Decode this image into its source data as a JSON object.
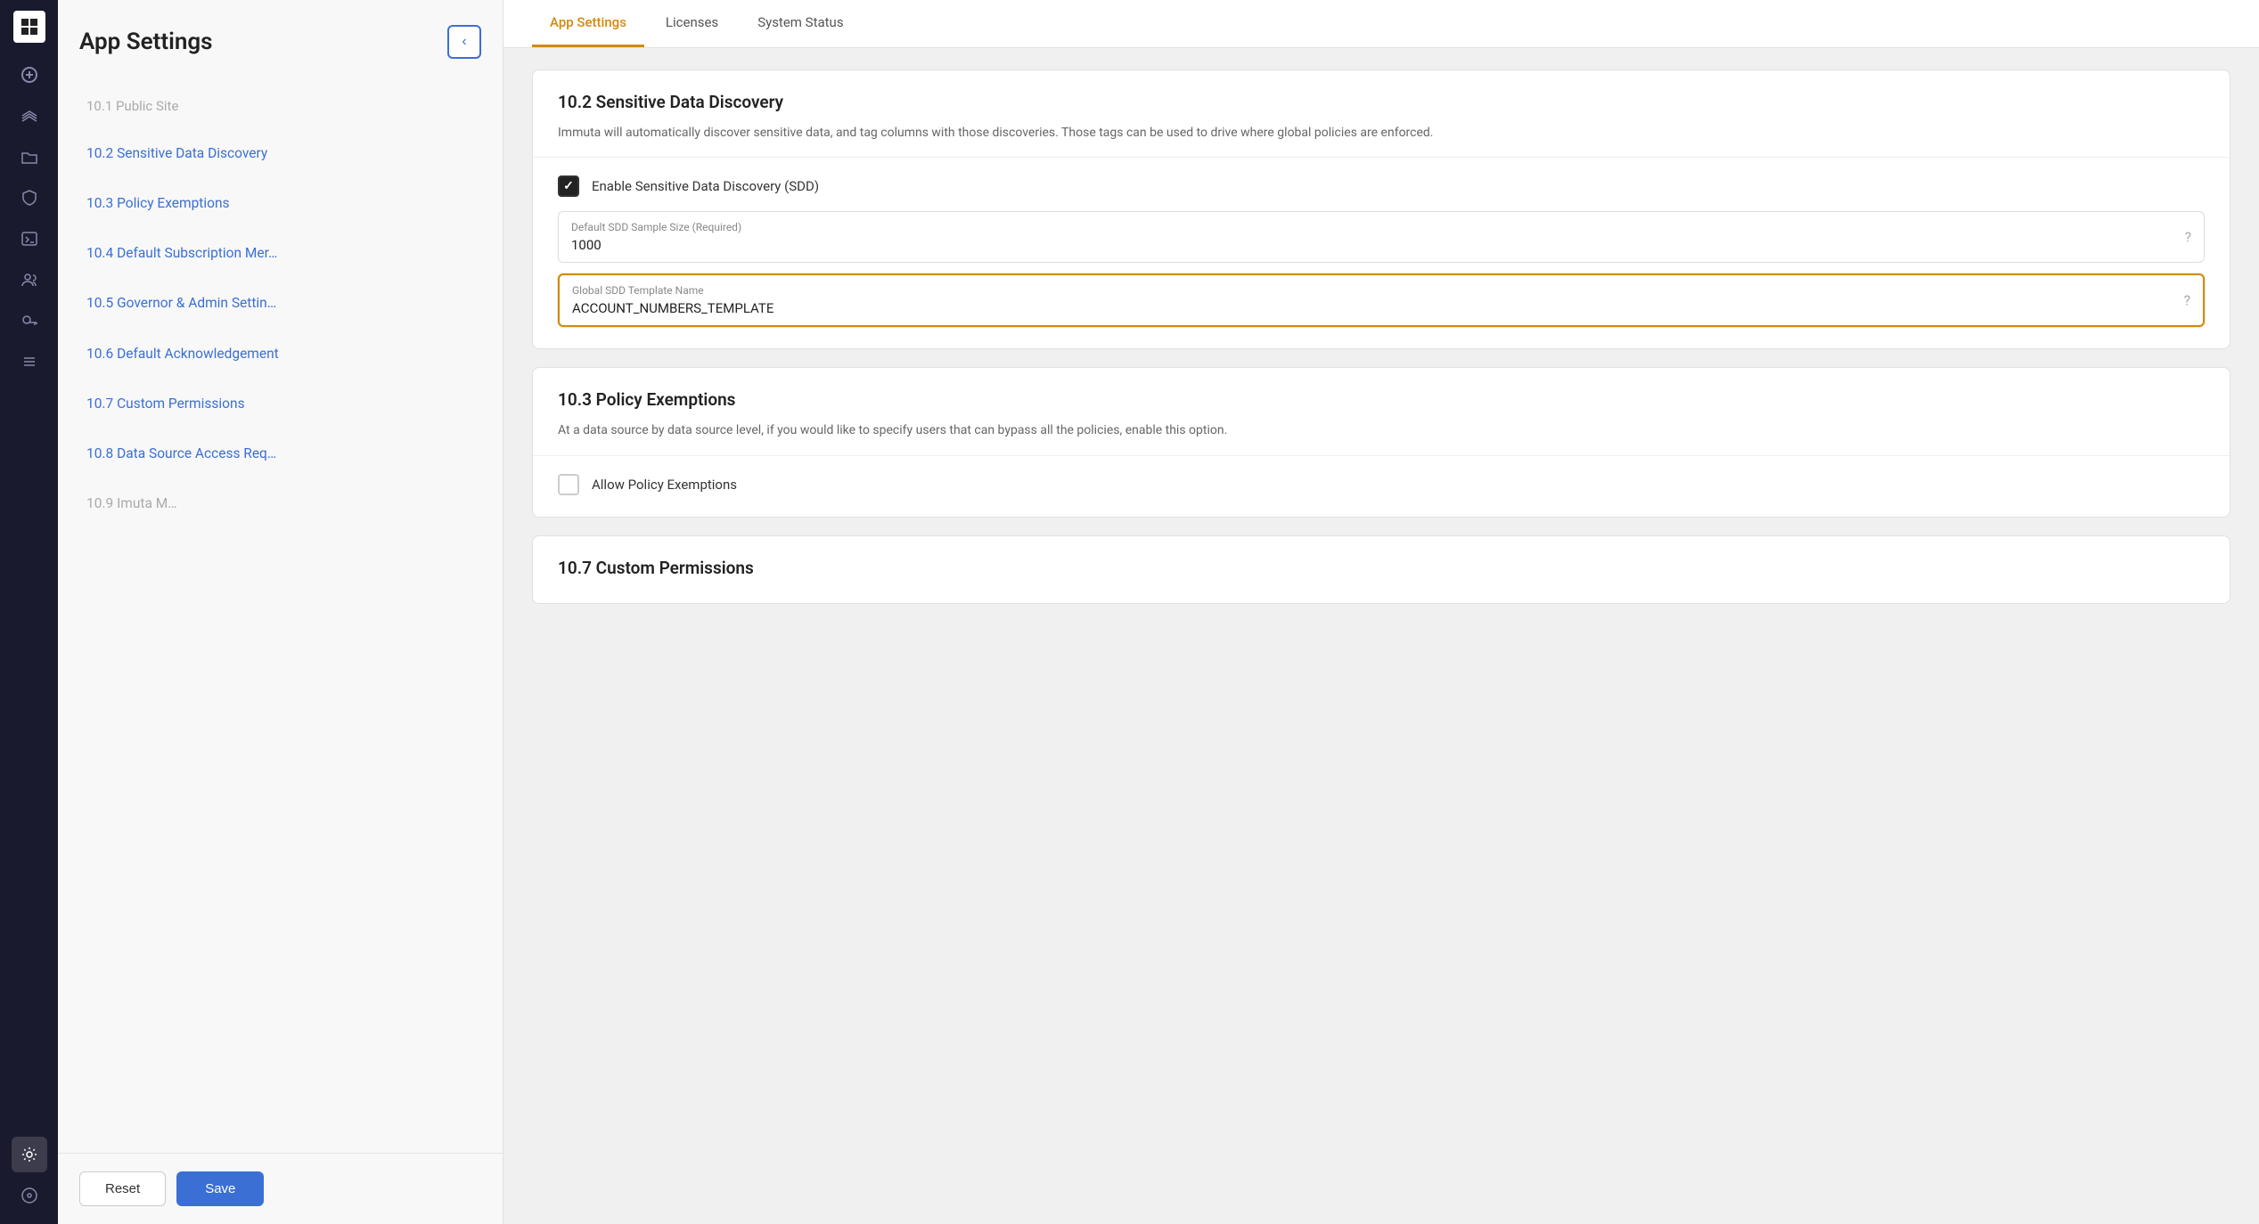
{
  "app": {
    "title": "App Settings"
  },
  "nav": {
    "logo_char": "▐",
    "icons": [
      {
        "name": "add-icon",
        "symbol": "+",
        "active": false
      },
      {
        "name": "layers-icon",
        "symbol": "⊞",
        "active": false
      },
      {
        "name": "folder-icon",
        "symbol": "🗂",
        "active": false
      },
      {
        "name": "shield-icon",
        "symbol": "⛨",
        "active": false
      },
      {
        "name": "terminal-icon",
        "symbol": ">_",
        "active": false
      },
      {
        "name": "users-icon",
        "symbol": "👥",
        "active": false
      },
      {
        "name": "key-icon",
        "symbol": "🔑",
        "active": false
      },
      {
        "name": "list-icon",
        "symbol": "≡",
        "active": false
      },
      {
        "name": "settings-icon",
        "symbol": "⚙",
        "active": true
      },
      {
        "name": "compass-icon",
        "symbol": "◎",
        "active": false
      }
    ]
  },
  "sidebar": {
    "title": "App Settings",
    "collapse_label": "‹",
    "items": [
      {
        "id": "item-10-2",
        "label": "10.2  Sensitive Data Discovery"
      },
      {
        "id": "item-10-3",
        "label": "10.3  Policy Exemptions"
      },
      {
        "id": "item-10-4",
        "label": "10.4  Default Subscription Mer…"
      },
      {
        "id": "item-10-5",
        "label": "10.5  Governor & Admin Settin…"
      },
      {
        "id": "item-10-6",
        "label": "10.6  Default Acknowledgement"
      },
      {
        "id": "item-10-7",
        "label": "10.7  Custom Permissions"
      },
      {
        "id": "item-10-8",
        "label": "10.8  Data Source Access Req…"
      },
      {
        "id": "item-10-9",
        "label": "10.9  Imuta M…"
      }
    ],
    "faded_top": "10.1  Public Site",
    "reset_label": "Reset",
    "save_label": "Save"
  },
  "tabs": [
    {
      "id": "tab-app-settings",
      "label": "App Settings",
      "active": true
    },
    {
      "id": "tab-licenses",
      "label": "Licenses",
      "active": false
    },
    {
      "id": "tab-system-status",
      "label": "System Status",
      "active": false
    }
  ],
  "sections": {
    "sdd": {
      "title": "10.2 Sensitive Data Discovery",
      "description": "Immuta will automatically discover sensitive data, and tag columns with those discoveries. Those tags can be used to drive where global policies are enforced.",
      "checkbox_label": "Enable Sensitive Data Discovery (SDD)",
      "checkbox_checked": true,
      "sample_size_label": "Default SDD Sample Size (Required)",
      "sample_size_value": "1000",
      "template_label": "Global SDD Template Name",
      "template_value": "ACCOUNT_NUMBERS_TEMPLATE",
      "template_focused": true
    },
    "policy_exemptions": {
      "title": "10.3 Policy Exemptions",
      "description": "At a data source by data source level, if you would like to specify users that can bypass all the policies, enable this option.",
      "checkbox_label": "Allow Policy Exemptions",
      "checkbox_checked": false
    },
    "custom_permissions": {
      "title": "10.7 Custom Permissions",
      "placeholder": ""
    }
  },
  "icons": {
    "help": "?",
    "chevron_left": "‹"
  }
}
